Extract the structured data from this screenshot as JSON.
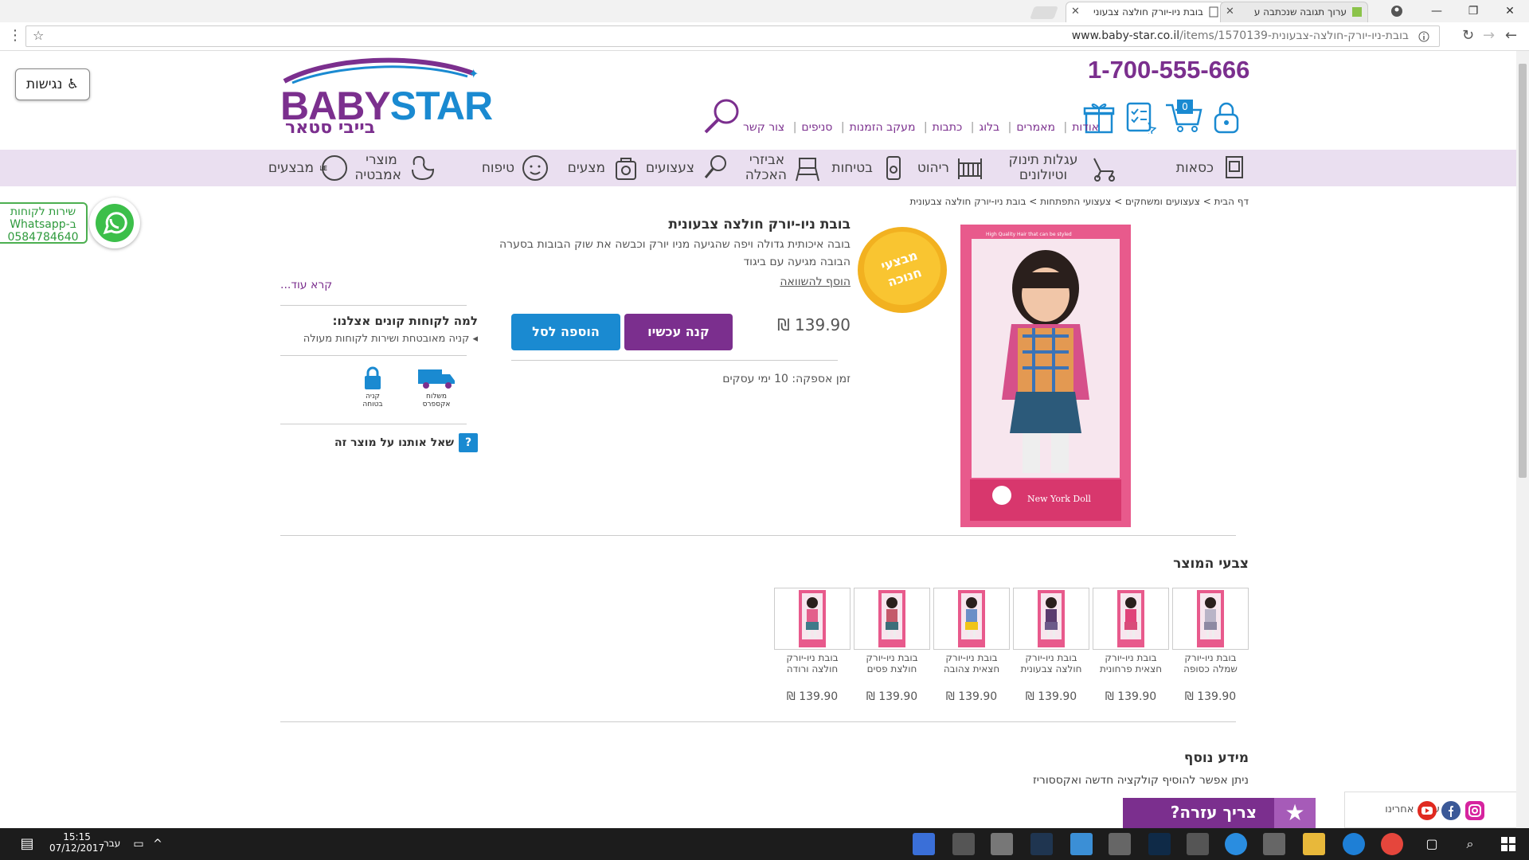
{
  "browser": {
    "tabs": [
      {
        "title": "בובת ניו-יורק חולצה צבעוני"
      },
      {
        "title": "ערוך תגובה שנכתבה ע"
      }
    ],
    "url_domain": "www.baby-star.co.il",
    "url_path": "/items/1570139-בובת-ניו-יורק-חולצה-צבעונית"
  },
  "a11y_button": "נגישות",
  "header": {
    "phone": "1-700-555-666",
    "logo_main": "BABY",
    "logo_star": "STAR",
    "logo_sub": "בייבי סטאר",
    "cart_count": "0",
    "top_links": [
      "אודות",
      "מאמרים",
      "בלוג",
      "כתבות",
      "מעקב הזמנות",
      "סניפים",
      "צור קשר"
    ]
  },
  "nav": {
    "items": [
      {
        "label": "כסאות"
      },
      {
        "label": "עגלות תינוק וטיולונים"
      },
      {
        "label": "ריהוט"
      },
      {
        "label": "בטיחות"
      },
      {
        "label": "אביזרי האכלה"
      },
      {
        "label": "צעצועים"
      },
      {
        "label": "מצעים"
      },
      {
        "label": "טיפוח"
      },
      {
        "label": "מוצרי אמבטיה"
      },
      {
        "label": "מבצעים"
      }
    ]
  },
  "whatsapp": {
    "line1": "שירות לקוחות",
    "line2": "ב-Whatsapp",
    "line3": "0584784640"
  },
  "breadcrumb": {
    "home": "דף הבית",
    "c1": "צעצועים ומשחקים",
    "c2": "צעצועי התפתחות",
    "c3": "בובת ניו-יורק חולצה צבעונית",
    "sep": ">"
  },
  "product": {
    "title": "בובת ניו-יורק חולצה צבעונית",
    "desc1": "בובה איכותית גדולה ויפה שהגיעה מניו יורק וכבשה את שוק הבובות בסערה",
    "desc2": "הבובה מגיעה עם ביגוד",
    "compare": "הוסף להשוואה",
    "read_more": "קרא עוד...",
    "price": "139.90 ₪",
    "buy_now": "קנה עכשיו",
    "add_to_cart": "הוספה לסל",
    "delivery": "זמן אספקה: 10 ימי עסקים",
    "badge_line1": "מבצעי",
    "badge_line2": "חנוכה",
    "box_label": "New York Doll",
    "box_top": "High Quality Hair that can be styled"
  },
  "why": {
    "title": "למה לקוחות קונים אצלנו:",
    "item": "קניה מאובטחת ושירות לקוחות מעולה",
    "f1_line1": "משלוח",
    "f1_line2": "אקספרס",
    "f2_line1": "קניה",
    "f2_line2": "בטוחה",
    "ask": "שאל אותנו על מוצר זה",
    "ask_icon": "?"
  },
  "variants_title": "צבעי המוצר",
  "variants": [
    {
      "name": "בובת ניו-יורק שמלה כסופה",
      "price": "139.90 ₪",
      "shirt": "#b9b4c7",
      "skirt": "#8e8aa3"
    },
    {
      "name": "בובת ניו-יורק חצאית פרחונית",
      "price": "139.90 ₪",
      "shirt": "#e0437a",
      "skirt": "#d94b7a"
    },
    {
      "name": "בובת ניו-יורק חולצה צבעונית",
      "price": "139.90 ₪",
      "shirt": "#5a3b6e",
      "skirt": "#6d5a8a"
    },
    {
      "name": "בובת ניו-יורק חצאית צהובה",
      "price": "139.90 ₪",
      "shirt": "#6b8ec7",
      "skirt": "#f0c419"
    },
    {
      "name": "בובת ניו-יורק חולצת פסים",
      "price": "139.90 ₪",
      "shirt": "#c45a6b",
      "skirt": "#3c6e7a"
    },
    {
      "name": "בובת ניו-יורק חולצה ורודה",
      "price": "139.90 ₪",
      "shirt": "#e35f8c",
      "skirt": "#3f7a8a"
    }
  ],
  "more_info": {
    "title": "מידע נוסף",
    "text": "ניתן אפשר להוסיף קולקציה חדשה ואקססוריז"
  },
  "help_button": "צריך עזרה?",
  "help_star": "★",
  "follow_text": "עקבו אחרינו",
  "taskbar": {
    "lang": "עבר",
    "time": "15:15",
    "date": "07/12/2017"
  },
  "colors": {
    "brand_purple": "#7b2f8e",
    "brand_blue": "#1a8ad1",
    "nav_bg": "#eadff0"
  }
}
